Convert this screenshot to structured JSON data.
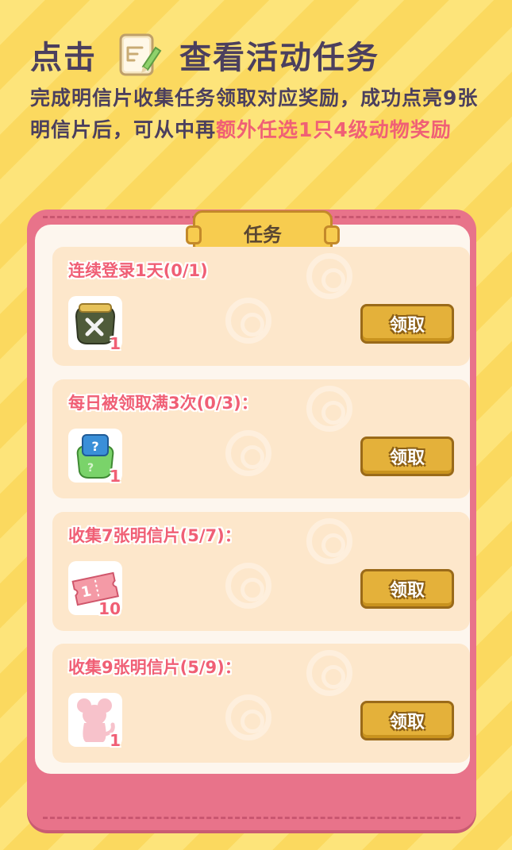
{
  "header": {
    "title_left": "点击",
    "title_right": "查看活动任务",
    "desc_normal": "完成明信片收集任务领取对应奖励，成功点亮9张明信片后，可从中再",
    "desc_highlight": "额外任选1只4级动物奖励"
  },
  "panel": {
    "tab_label": "任务",
    "tasks": [
      {
        "label": "连续登录1天(0/1)",
        "reward_icon": "tool-bag-icon",
        "reward_count": "1",
        "button": "领取"
      },
      {
        "label": "每日被领取满3次(0/3)：",
        "reward_icon": "mystery-bag-icon",
        "reward_count": "1",
        "button": "领取"
      },
      {
        "label": "收集7张明信片(5/7)：",
        "reward_icon": "ticket-icon",
        "reward_count": "10",
        "button": "领取"
      },
      {
        "label": "收集9张明信片(5/9)：",
        "reward_icon": "animal-silhouette-icon",
        "reward_count": "1",
        "button": "领取"
      }
    ]
  },
  "colors": {
    "accent_pink": "#f06075",
    "title_dark": "#4b3f5e",
    "button_gold": "#e4b13a",
    "panel_pink": "#e8738a"
  }
}
